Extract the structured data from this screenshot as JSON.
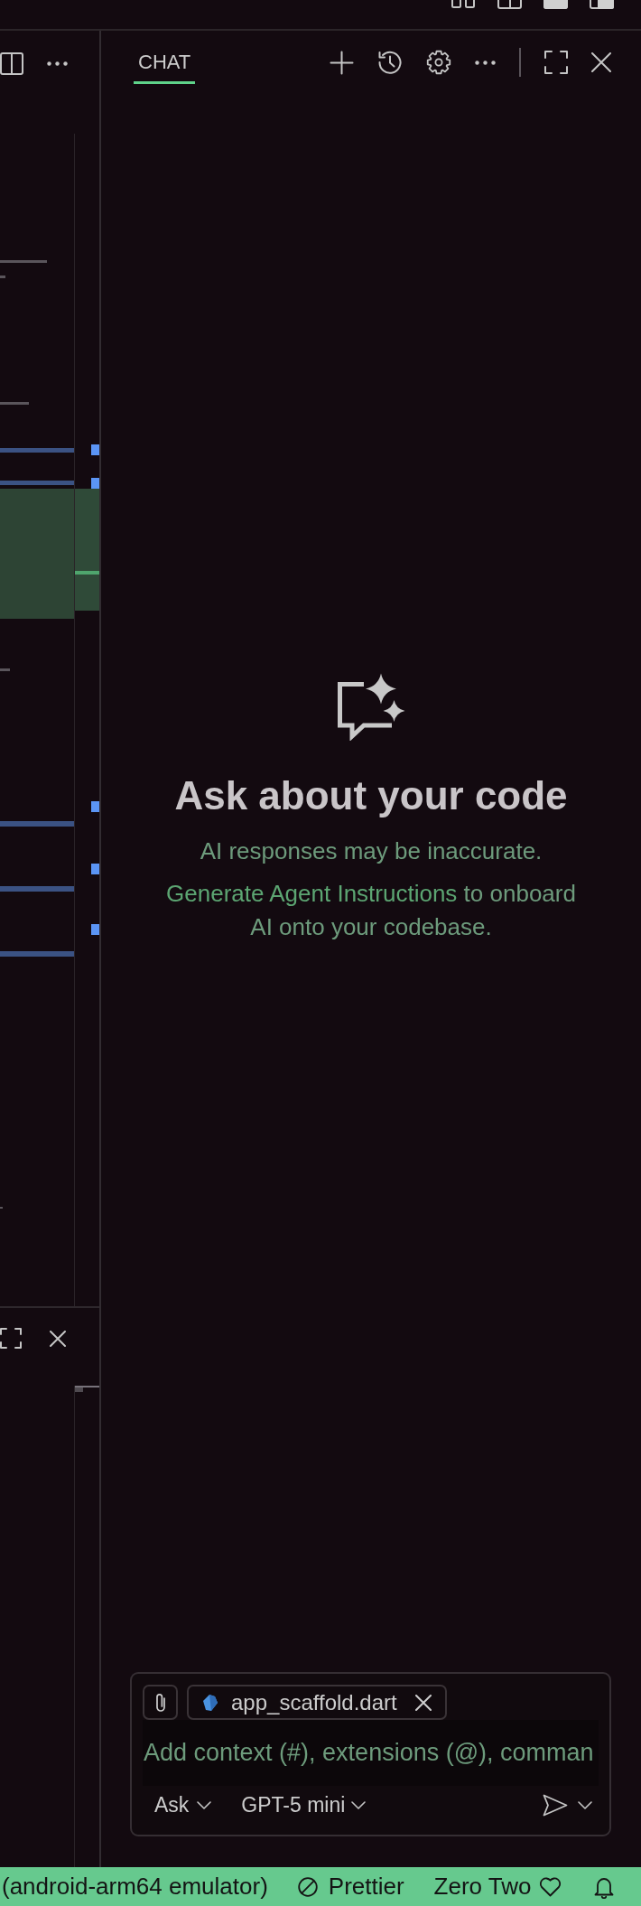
{
  "title_bar": {
    "layout_controls": [
      {
        "kind": "customize_layout"
      },
      {
        "kind": "primary_sidebar",
        "on": false
      },
      {
        "kind": "panel",
        "on": true
      },
      {
        "kind": "secondary_sidebar",
        "on": true
      }
    ]
  },
  "chat": {
    "tabs": [
      {
        "label": "CHAT",
        "selected": true
      }
    ],
    "empty_state": {
      "title": "Ask about your code",
      "disclaimer": "AI responses may be inaccurate.",
      "instructions_link": "Generate Agent Instructions",
      "instructions_text": "to onboard AI onto your codebase."
    },
    "composer": {
      "attachments": [
        {
          "name": "app_scaffold.dart"
        }
      ],
      "placeholder": "Add context (#), extensions (@), comman",
      "mode": "Ask",
      "model": "GPT-5 mini"
    }
  },
  "status_bar": {
    "items": [
      {
        "kind": "text",
        "label": "(android-arm64 emulator)"
      },
      {
        "kind": "formatter",
        "label": "Prettier"
      },
      {
        "kind": "account",
        "label": "Zero Two"
      },
      {
        "kind": "notifications"
      }
    ]
  }
}
